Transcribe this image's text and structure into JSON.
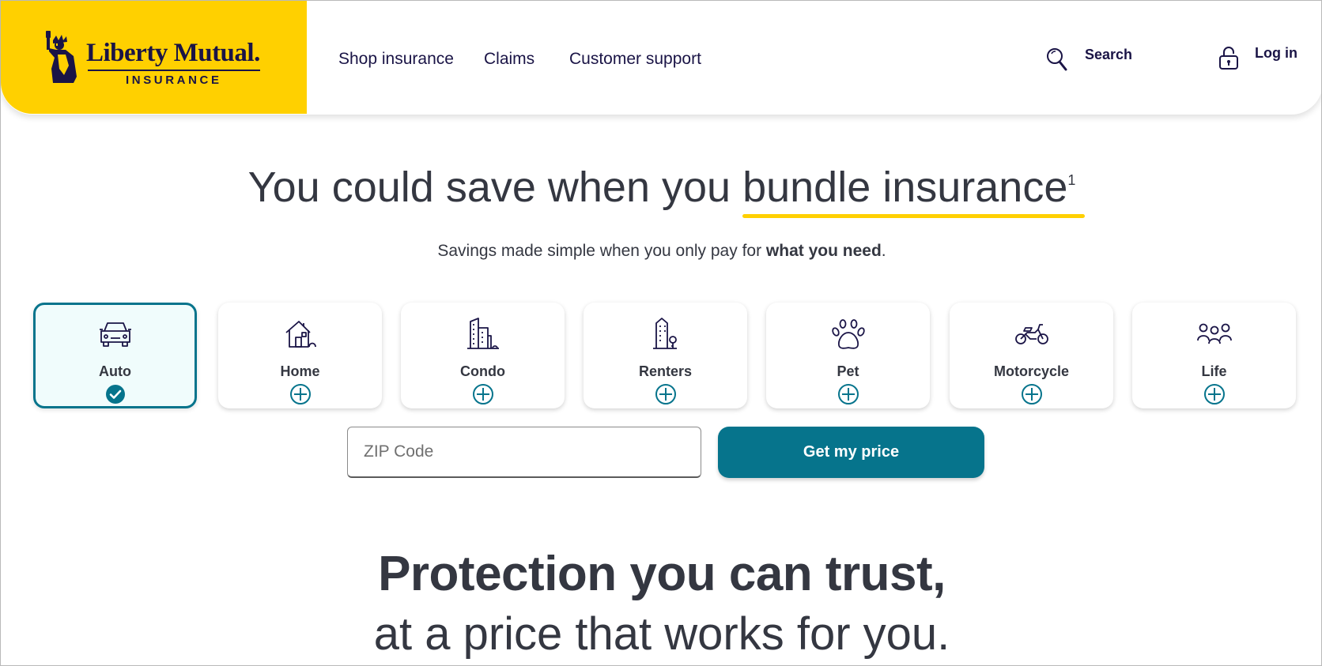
{
  "brand": {
    "name": "Liberty Mutual.",
    "sub": "INSURANCE",
    "color_yellow": "#ffd000",
    "color_navy": "#1a1446",
    "color_teal": "#06748c"
  },
  "nav": {
    "items": [
      {
        "label": "Shop insurance"
      },
      {
        "label": "Claims"
      },
      {
        "label": "Customer support"
      }
    ],
    "search_label": "Search",
    "search_icon": "search-icon",
    "login_label": "Log in",
    "login_icon": "lock-icon"
  },
  "hero": {
    "headline_lead": "You could save when you ",
    "headline_emph": "bundle insurance",
    "headline_sup": "1",
    "subline_lead": "Savings made simple when you only pay for ",
    "subline_bold": "what you need",
    "subline_end": "."
  },
  "products": [
    {
      "label": "Auto",
      "icon": "car-icon",
      "selected": true
    },
    {
      "label": "Home",
      "icon": "house-icon",
      "selected": false
    },
    {
      "label": "Condo",
      "icon": "condo-building-icon",
      "selected": false
    },
    {
      "label": "Renters",
      "icon": "renters-building-icon",
      "selected": false
    },
    {
      "label": "Pet",
      "icon": "paw-icon",
      "selected": false
    },
    {
      "label": "Motorcycle",
      "icon": "motorcycle-icon",
      "selected": false
    },
    {
      "label": "Life",
      "icon": "family-icon",
      "selected": false
    }
  ],
  "quote": {
    "zip_placeholder": "ZIP Code",
    "zip_value": "",
    "button_label": "Get my price"
  },
  "tagline": {
    "line1": "Protection you can trust,",
    "line2": "at a price that works for you."
  }
}
